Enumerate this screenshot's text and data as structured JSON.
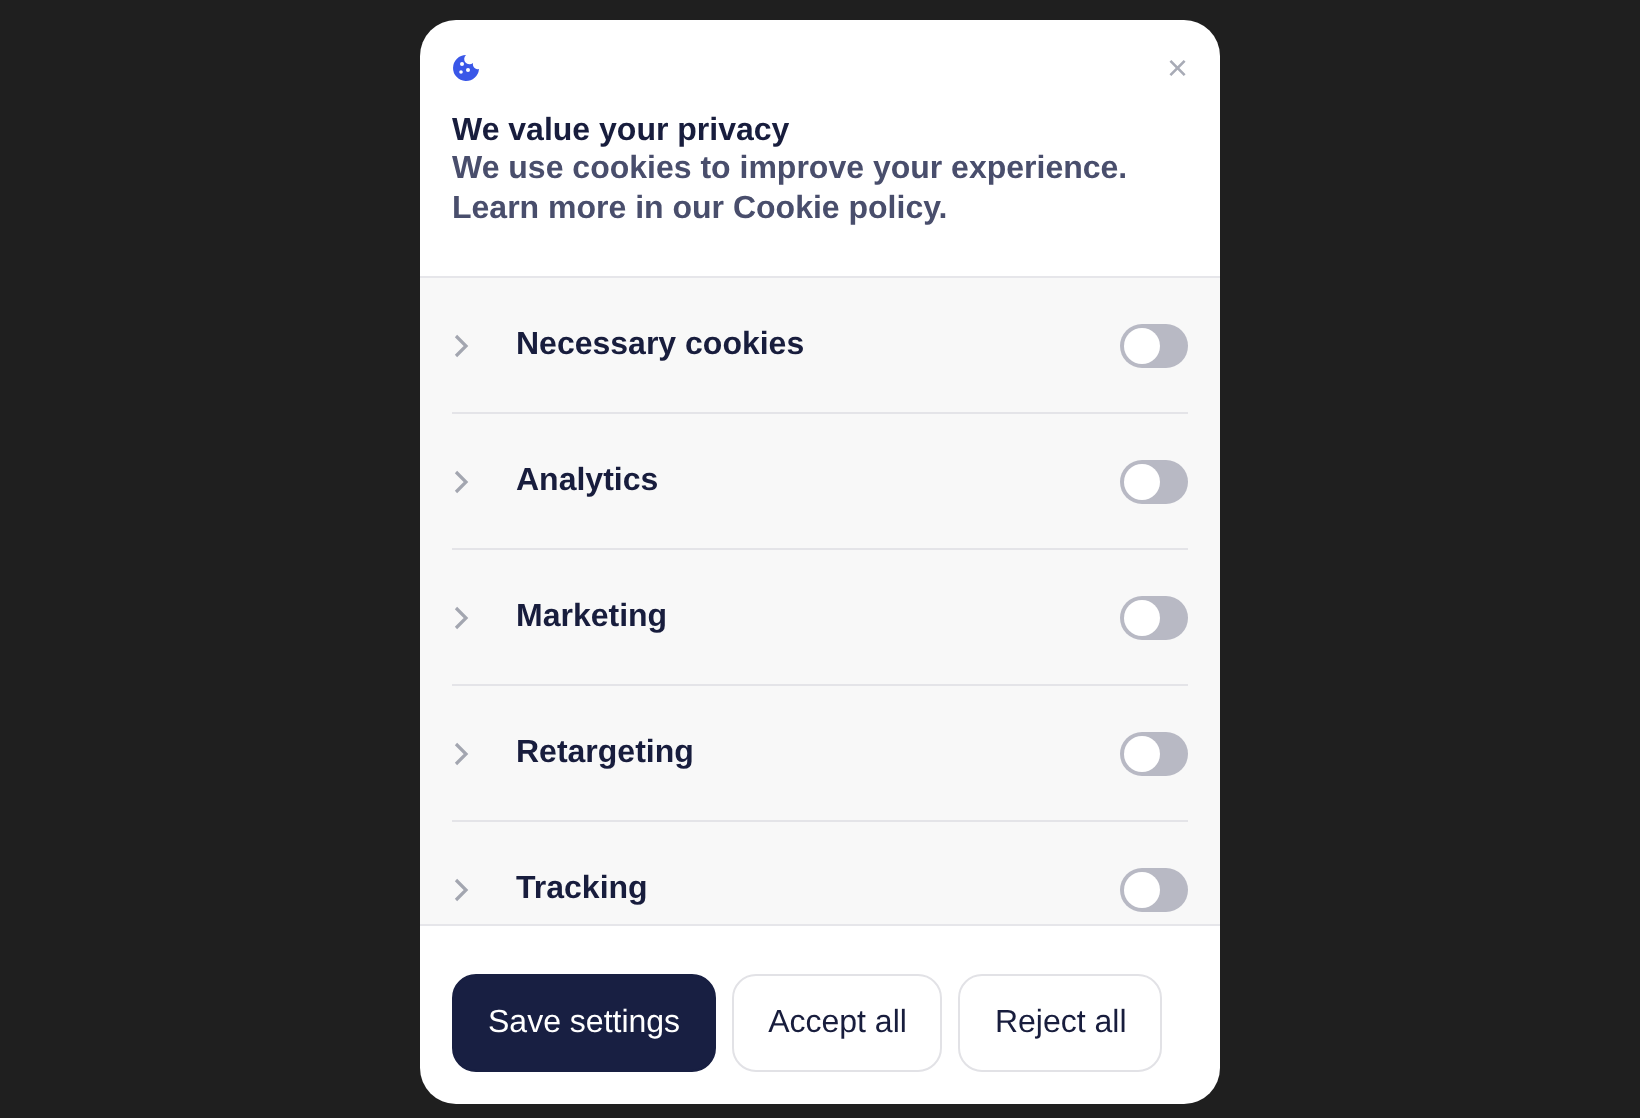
{
  "dialog": {
    "title": "We value your privacy",
    "description": "We use cookies to improve your experience. Learn more in our Cookie policy.",
    "close": "×"
  },
  "categories": [
    {
      "label": "Necessary cookies",
      "on": false,
      "expanded": false
    },
    {
      "label": "Analytics",
      "on": false,
      "expanded": false
    },
    {
      "label": "Marketing",
      "on": false,
      "expanded": false
    },
    {
      "label": "Retargeting",
      "on": false,
      "expanded": false
    },
    {
      "label": "Tracking",
      "on": false,
      "expanded": false
    }
  ],
  "buttons": [
    {
      "label": "Save settings",
      "kind": "primary"
    },
    {
      "label": "Accept all",
      "kind": "secondary"
    },
    {
      "label": "Reject all",
      "kind": "secondary"
    }
  ]
}
